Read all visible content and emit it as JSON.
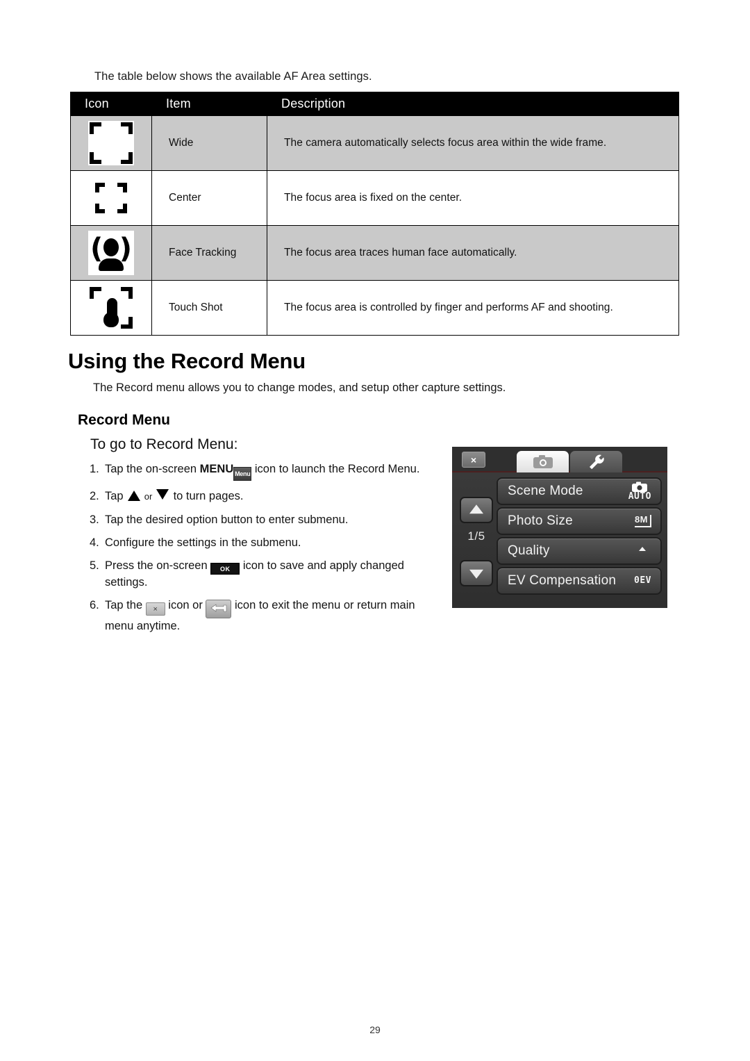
{
  "intro_text": "The table below shows the available AF Area settings.",
  "af_table": {
    "headers": [
      "Icon",
      "Item",
      "Description"
    ],
    "rows": [
      {
        "icon_name": "af-wide-icon",
        "item": "Wide",
        "description": "The camera automatically selects focus area within the wide frame."
      },
      {
        "icon_name": "af-center-icon",
        "item": "Center",
        "description": "The focus area is fixed on the center."
      },
      {
        "icon_name": "af-face-tracking-icon",
        "item": "Face Tracking",
        "description": "The focus area traces human face automatically."
      },
      {
        "icon_name": "af-touch-shot-icon",
        "item": "Touch Shot",
        "description": "The focus area is controlled by finger and performs AF and shooting."
      }
    ]
  },
  "section": {
    "title": "Using the Record Menu",
    "lead": "The Record menu allows you to change modes, and setup other capture settings.",
    "subtitle": "Record Menu",
    "subsubtitle": "To go to Record Menu:"
  },
  "steps": [
    {
      "num": "1.",
      "parts": [
        {
          "t": "text",
          "v": "Tap the on-screen "
        },
        {
          "t": "bold",
          "v": "MENU"
        },
        {
          "t": "icon",
          "v": "Menu"
        },
        {
          "t": "text",
          "v": " icon to launch the Record Menu."
        }
      ],
      "text_plain": "Tap the on-screen MENU icon to launch the Record Menu."
    },
    {
      "num": "2.",
      "text_plain": "Tap ▲ or ▼ to turn pages.",
      "pre": "Tap ",
      "mid": " or ",
      "post": " to turn pages."
    },
    {
      "num": "3.",
      "text_plain": "Tap the desired option button to enter submenu."
    },
    {
      "num": "4.",
      "text_plain": "Configure the settings in the submenu."
    },
    {
      "num": "5.",
      "pre": "Press the on-screen ",
      "icon_label": "OK",
      "post": " icon to save and apply changed settings.",
      "text_plain": "Press the on-screen OK icon to save and apply changed settings."
    },
    {
      "num": "6.",
      "pre": "Tap the ",
      "icon_label_a": "×",
      "mid": " icon or ",
      "post": " icon to exit the menu or return main menu anytime.",
      "text_plain": "Tap the × icon or ↩ icon to exit the menu or return main menu anytime."
    }
  ],
  "lcd": {
    "close_label": "×",
    "tabs": [
      {
        "name": "record-tab",
        "icon": "camera-icon",
        "active": true
      },
      {
        "name": "setup-tab",
        "icon": "wrench-icon",
        "active": false
      }
    ],
    "page_indicator": "1/5",
    "nav_up_icon": "triangle-up-icon",
    "nav_down_icon": "triangle-down-icon",
    "items": [
      {
        "label": "Scene Mode",
        "value": "AUTO",
        "value_kind": "camera-auto"
      },
      {
        "label": "Photo Size",
        "value": "8M",
        "value_kind": "resolution"
      },
      {
        "label": "Quality",
        "value": "",
        "value_kind": "quality-bars"
      },
      {
        "label": "EV Compensation",
        "value": "0EV",
        "value_kind": "text"
      }
    ]
  },
  "footer": {
    "page_number": "29"
  },
  "colors": {
    "table_header_bg": "#000000",
    "row_shaded_bg": "#c9c9c9",
    "row_plain_bg": "#ffffff",
    "lcd_bg": "#2b2b2b",
    "text": "#111111"
  }
}
